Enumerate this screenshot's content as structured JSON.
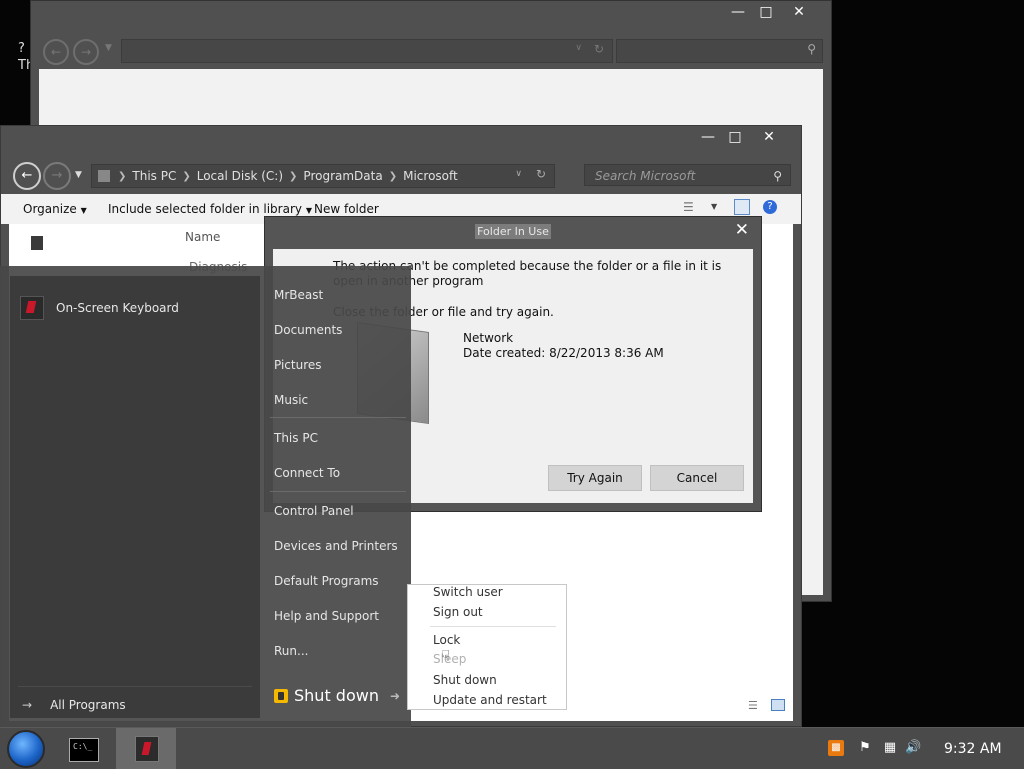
{
  "background_fragment": {
    "line1": "?",
    "line2": "Th"
  },
  "main_window": {
    "breadcrumb": [
      "This PC",
      "Local Disk (C:)",
      "ProgramData",
      "Microsoft"
    ],
    "search_placeholder": "Search Microsoft",
    "toolbar": {
      "organize": "Organize",
      "include_library": "Include selected folder in library",
      "new_folder": "New folder"
    },
    "column_name": "Name",
    "file_fragment": "Diagnosis"
  },
  "dialog": {
    "title": "Folder In Use",
    "message": "The action can't be completed because the folder or a file in it is open in another program",
    "instruction": "Close the folder or file and try again.",
    "item_name": "Network",
    "item_date": "Date created: 8/22/2013 8:36 AM",
    "try_again": "Try Again",
    "cancel": "Cancel"
  },
  "start_menu": {
    "pinned_app": "On-Screen Keyboard",
    "all_programs": "All Programs",
    "links": [
      "MrBeast",
      "Documents",
      "Pictures",
      "Music",
      "This PC",
      "Connect To",
      "Control Panel",
      "Devices and Printers",
      "Default Programs",
      "Help and Support",
      "Run..."
    ],
    "shutdown": "Shut down"
  },
  "power_menu": {
    "switch_user": "Switch user",
    "sign_out": "Sign out",
    "lock": "Lock",
    "sleep": "Sleep",
    "shut_down": "Shut down",
    "update_restart": "Update and restart"
  },
  "taskbar": {
    "clock": "9:32 AM",
    "cmd_prompt_glyph": "C:\\_"
  }
}
